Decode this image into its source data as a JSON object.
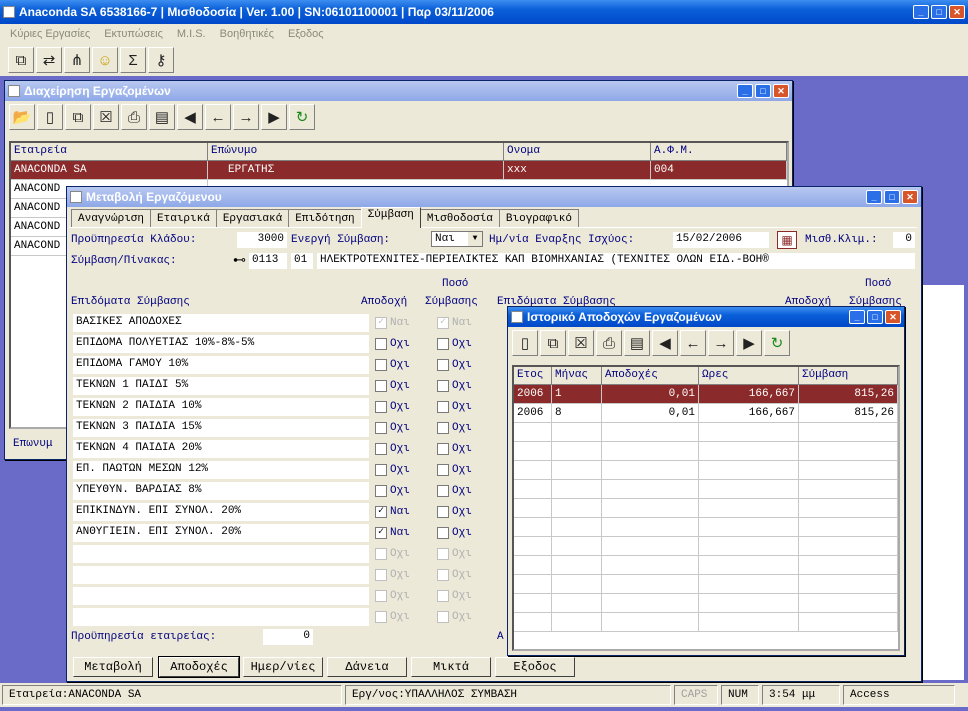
{
  "app": {
    "title": "Anaconda SA 6538166-7 | Μισθοδοσία | Ver. 1.00 | SN:06101100001 | Παρ 03/11/2006",
    "menu": [
      "Κύριες Εργασίες",
      "Εκτυπώσεις",
      "M.I.S.",
      "Βοηθητικές",
      "Εξοδος"
    ],
    "toolbar_icons": [
      "org-chart-icon",
      "transfer-icon",
      "hierarchy-icon",
      "smiley-icon",
      "sigma-icon",
      "key-icon"
    ]
  },
  "employees": {
    "title": "Διαχείρηση Εργαζομένων",
    "columns": [
      "Εταιρεία",
      "Επώνυμο",
      "Ονομα",
      "Α.Φ.Μ."
    ],
    "rows": [
      [
        "ANACONDA SA",
        "ΕΡΓΑΤΗΣ",
        "xxx",
        "004"
      ],
      [
        "ANACOND",
        "",
        "",
        ""
      ],
      [
        "ANACOND",
        "",
        "",
        ""
      ],
      [
        "ANACOND",
        "",
        "",
        ""
      ],
      [
        "ANACOND",
        "",
        "",
        ""
      ]
    ],
    "search_label": "Επωνυμ"
  },
  "edit": {
    "title": "Μεταβολή Εργαζόμενου",
    "tabs": [
      "Αναγνώριση",
      "Εταιρικά",
      "Εργασιακά",
      "Επιδότηση",
      "Σύμβαση",
      "Μισθοδοσία",
      "Βιογραφικό"
    ],
    "active_tab": "Σύμβαση",
    "seniority_label": "Προϋπηρεσία Κλάδου:",
    "seniority_value": "3000",
    "active_contract_label": "Ενεργή Σύμβαση:",
    "active_contract_value": "Ναι",
    "start_date_label": "Ημ/νία Εναρξης Ισχύος:",
    "start_date_value": "15/02/2006",
    "pay_scale_label": "Μισθ.Κλιμ.:",
    "pay_scale_value": "0",
    "contract_label": "Σύμβαση/Πίνακας:",
    "contract_code": "0113",
    "contract_sub": "01",
    "contract_desc": "ΗΛΕΚΤΡΟΤΕΧΝΙΤΕΣ-ΠΕΡΙΕΛΙΚΤΕΣ ΚΑΠ ΒΙΟΜΗΧΑΝΙΑΣ  (ΤΕΧΝΙΤΕΣ ΟΛΩΝ ΕΙΔ.-ΒΟΗ®",
    "col_allowances": "Επιδόματα Σύμβασης",
    "col_accept": "Αποδοχή",
    "col_amount": "Ποσό",
    "col_contract": "Σύμβασης",
    "allowances": [
      {
        "name": "ΒΑΣΙΚΕΣ ΑΠΟΔΟΧΕΣ",
        "accept": "Ναι",
        "contract": "Ναι",
        "checked": true,
        "disabled": true
      },
      {
        "name": "ΕΠΙΔΟΜΑ ΠΟΛΥΕΤΙΑΣ 10%-8%-5%",
        "accept": "Οχι",
        "contract": "Οχι",
        "checked": false,
        "disabled": false
      },
      {
        "name": "ΕΠΙΔΟΜΑ ΓΑΜΟΥ 10%",
        "accept": "Οχι",
        "contract": "Οχι",
        "checked": false,
        "disabled": false
      },
      {
        "name": "ΤΕΚΝΩΝ 1 ΠΑΙΔΙ 5%",
        "accept": "Οχι",
        "contract": "Οχι",
        "checked": false,
        "disabled": false
      },
      {
        "name": "ΤΕΚΝΩΝ 2 ΠΑΙΔΙΑ 10%",
        "accept": "Οχι",
        "contract": "Οχι",
        "checked": false,
        "disabled": false
      },
      {
        "name": "ΤΕΚΝΩΝ 3  ΠΑΙΔΙΑ 15%",
        "accept": "Οχι",
        "contract": "Οχι",
        "checked": false,
        "disabled": false
      },
      {
        "name": "ΤΕΚΝΩΝ 4 ΠΑΙΔΙΑ 20%",
        "accept": "Οχι",
        "contract": "Οχι",
        "checked": false,
        "disabled": false
      },
      {
        "name": "ΕΠ. ΠΑΩΤΩΝ ΜΕΣΩΝ 12%",
        "accept": "Οχι",
        "contract": "Οχι",
        "checked": false,
        "disabled": false
      },
      {
        "name": "ΥΠΕΥΘΥΝ. ΒΑΡΔΙΑΣ 8%",
        "accept": "Οχι",
        "contract": "Οχι",
        "checked": false,
        "disabled": false
      },
      {
        "name": "ΕΠΙΚΙΝΔΥΝ. ΕΠΙ ΣΥΝΟΛ. 20%",
        "accept": "Ναι",
        "contract": "Οχι",
        "checked": true,
        "disabled": false
      },
      {
        "name": "ΑΝΘΥΓΙΕΙΝ. ΕΠΙ ΣΥΝΟΛ. 20%",
        "accept": "Ναι",
        "contract": "Οχι",
        "checked": true,
        "disabled": false
      },
      {
        "name": "",
        "accept": "Οχι",
        "contract": "Οχι",
        "checked": false,
        "disabled": true
      },
      {
        "name": "",
        "accept": "Οχι",
        "contract": "Οχι",
        "checked": false,
        "disabled": true
      },
      {
        "name": "",
        "accept": "Οχι",
        "contract": "Οχι",
        "checked": false,
        "disabled": true
      },
      {
        "name": "",
        "accept": "Οχι",
        "contract": "Οχι",
        "checked": false,
        "disabled": true
      }
    ],
    "company_seniority_label": "Προϋπηρεσία εταιρείας:",
    "company_seniority_value": "0",
    "right_label": "Α",
    "buttons": [
      "Μεταβολή",
      "Αποδοχές",
      "Ημερ/νίες",
      "Δάνεια",
      "Μικτά",
      "Εξοδος"
    ]
  },
  "history": {
    "title": "Ιστορικό Αποδοχών Εργαζομένων",
    "columns": [
      "Ετος",
      "Μήνας",
      "Αποδοχές",
      "Ωρες",
      "Σύμβαση"
    ],
    "rows": [
      [
        "2006",
        "1",
        "0,01",
        "166,667",
        "815,26"
      ],
      [
        "2006",
        "8",
        "0,01",
        "166,667",
        "815,26"
      ]
    ]
  },
  "status": {
    "company": "Εταιρεία:ANACONDA SA",
    "employment": "Εργ/νος:ΥΠΑΛΛΗΛΟΣ ΣΥΜΒΑΣΗ",
    "caps": "CAPS",
    "num": "NUM",
    "time": "3:54 μμ",
    "app": "Access"
  }
}
